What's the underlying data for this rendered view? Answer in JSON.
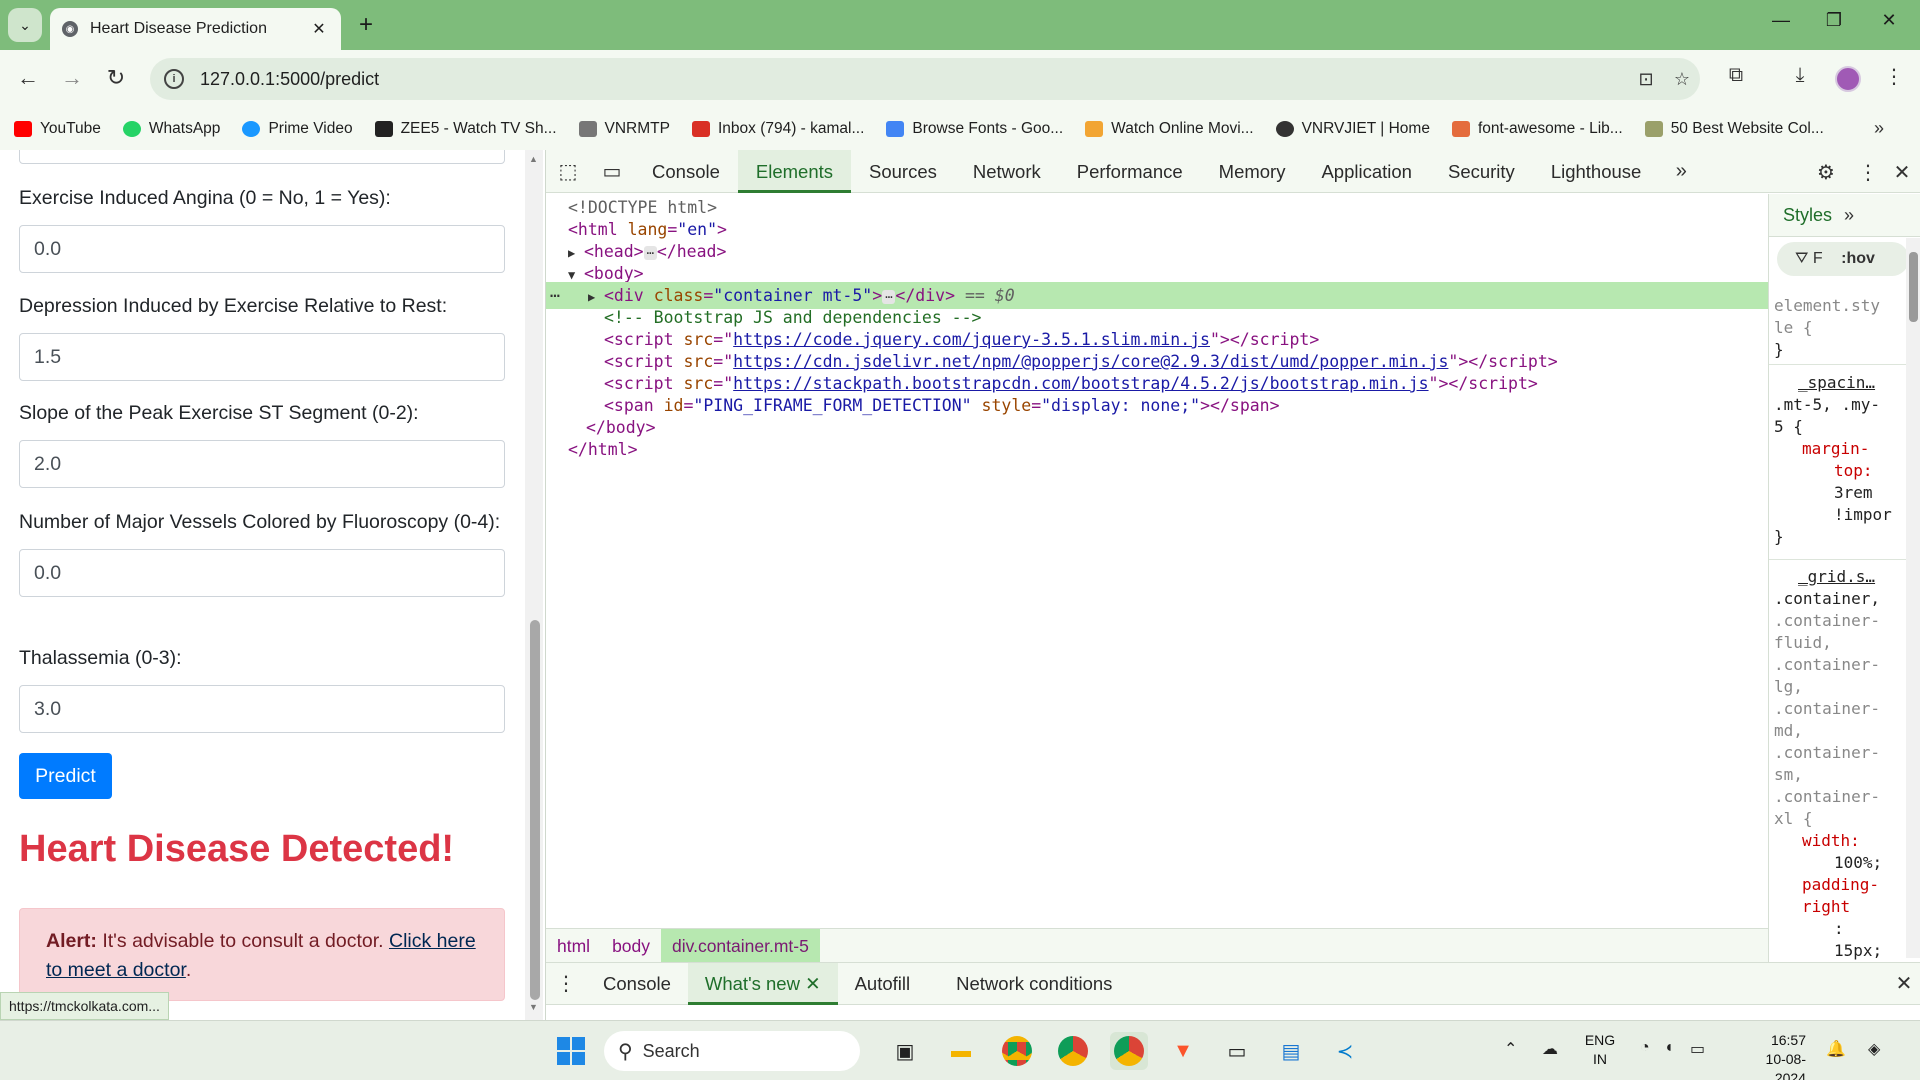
{
  "browser": {
    "tab_title": "Heart Disease Prediction",
    "tab_close": "✕",
    "new_tab": "+",
    "url": "127.0.0.1:5000/predict",
    "window_controls": [
      "—",
      "❐",
      "✕"
    ]
  },
  "bookmarks": [
    {
      "label": "YouTube",
      "color": "#ff0000"
    },
    {
      "label": "WhatsApp",
      "color": "#25d366"
    },
    {
      "label": "Prime Video",
      "color": "#1a98ff"
    },
    {
      "label": "ZEE5 - Watch TV Sh...",
      "color": "#222222"
    },
    {
      "label": "VNRMTP",
      "color": "#777777"
    },
    {
      "label": "Inbox (794) - kamal...",
      "color": "#d93025"
    },
    {
      "label": "Browse Fonts - Goo...",
      "color": "#4285f4"
    },
    {
      "label": "Watch Online Movi...",
      "color": "#f2a533"
    },
    {
      "label": "VNRVJIET | Home",
      "color": "#333333"
    },
    {
      "label": "font-awesome - Lib...",
      "color": "#e46c3d"
    },
    {
      "label": "50 Best Website Col...",
      "color": "#9aa06a"
    }
  ],
  "form": {
    "fields": [
      {
        "label": "Exercise Induced Angina (0 = No, 1 = Yes):",
        "value": "0.0"
      },
      {
        "label": "Depression Induced by Exercise Relative to Rest:",
        "value": "1.5"
      },
      {
        "label": "Slope of the Peak Exercise ST Segment (0-2):",
        "value": "2.0"
      },
      {
        "label": "Number of Major Vessels Colored by Fluoroscopy (0-4):",
        "value": "0.0"
      },
      {
        "label": "Thalassemia (0-3):",
        "value": "3.0"
      }
    ],
    "submit_label": "Predict",
    "result_heading": "Heart Disease Detected!",
    "alert_strong": "Alert:",
    "alert_text": " It's advisable to consult a doctor. ",
    "alert_link": "Click here to meet a doctor",
    "alert_end": "."
  },
  "status_url": "https://tmckolkata.com...",
  "devtools": {
    "tabs": [
      "Console",
      "Elements",
      "Sources",
      "Network",
      "Performance",
      "Memory",
      "Application",
      "Security",
      "Lighthouse"
    ],
    "active_tab": "Elements",
    "dom": {
      "doctype": "<!DOCTYPE html>",
      "html_open": "<html",
      "html_lang_attr": "lang",
      "html_lang_val": "\"en\"",
      "head": "<head>",
      "head_close": "</head>",
      "body": "<body>",
      "div_open": "<div",
      "div_class_attr": "class",
      "div_class_val": "\"container mt-5\"",
      "div_close": "</div>",
      "sel_marker": "== $0",
      "comment": "<!-- Bootstrap JS and dependencies -->",
      "script_src": "src",
      "script1": "https://code.jquery.com/jquery-3.5.1.slim.min.js",
      "script2": "https://cdn.jsdelivr.net/npm/@popperjs/core@2.9.3/dist/umd/popper.min.js",
      "script3": "https://stackpath.bootstrapcdn.com/bootstrap/4.5.2/js/bootstrap.min.js",
      "span_id_val": "\"PING_IFRAME_FORM_DETECTION\"",
      "span_style_val": "\"display: none;\"",
      "body_close": "</body>",
      "html_close": "</html>"
    },
    "breadcrumbs": [
      "html",
      "body",
      "div.container.mt-5"
    ],
    "styles": {
      "header": "Styles",
      "filter": "F",
      "hov": ":hov",
      "rule1_sel_a": "element.sty",
      "rule1_sel_b": "le {",
      "rule2_src": "_spacin…",
      "rule2_sel": ".mt-5, .my-",
      "rule2_sel2": "5 {",
      "rule2_prop_a": "margin-",
      "rule2_prop_b": "top:",
      "rule2_val_a": "3rem",
      "rule2_val_b": "!impor",
      "rule3_src": "_grid.s…",
      "rule3_lines": [
        ".container,",
        ".container-",
        "fluid,",
        ".container-",
        "lg,",
        ".container-",
        "md,",
        ".container-",
        "sm,",
        ".container-",
        "xl {"
      ],
      "rule3_prop1": "width:",
      "rule3_val1": "100%;",
      "rule3_prop2a": "padding-",
      "rule3_prop2b": "right",
      "rule3_colon": ":",
      "rule3_val2": "15px;"
    },
    "drawer_tabs": [
      "Console",
      "What's new",
      "Autofill",
      "Network conditions"
    ],
    "drawer_active": "What's new"
  },
  "taskbar": {
    "search_placeholder": "Search",
    "lang_top": "ENG",
    "lang_bottom": "IN",
    "time": "16:57",
    "date": "10-08-2024"
  }
}
